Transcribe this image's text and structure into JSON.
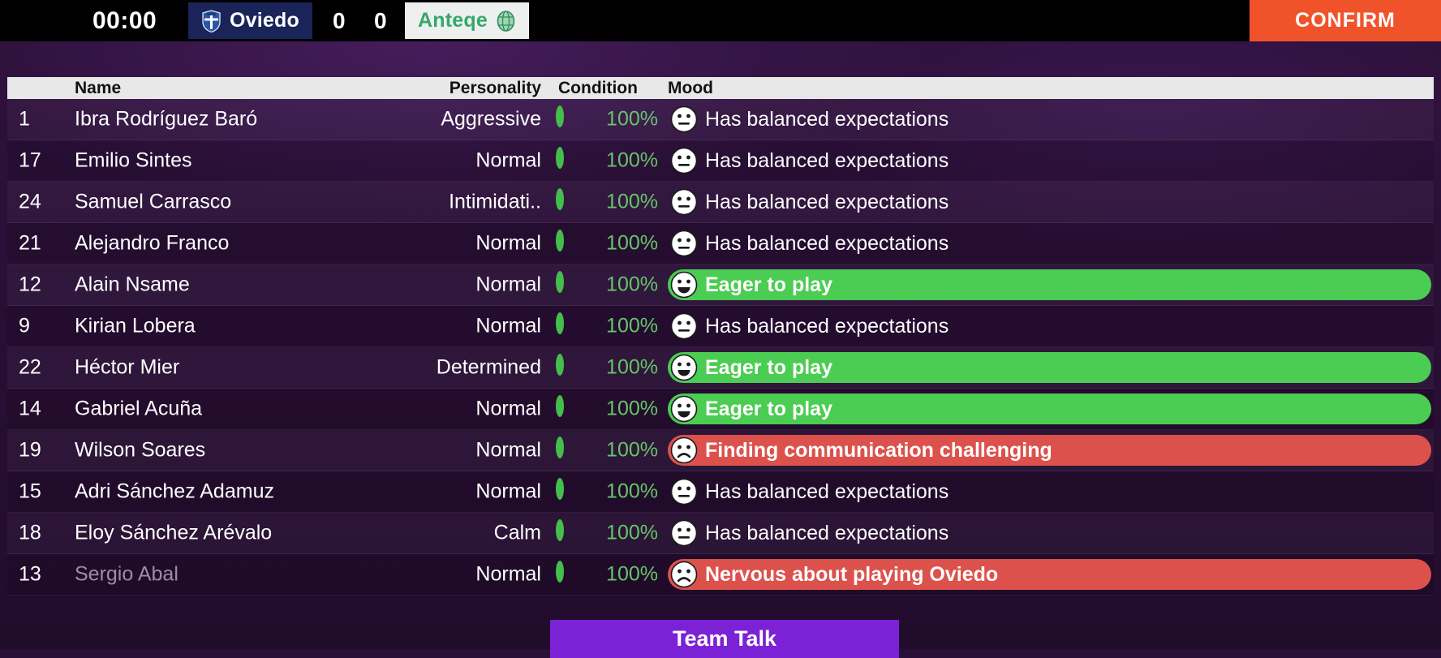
{
  "scoreboard": {
    "clock": "00:00",
    "home_team": "Oviedo",
    "home_score": "0",
    "away_score": "0",
    "away_team": "Anteqe",
    "home_badge_icon": "oviedo-shield-badge-icon",
    "away_badge_icon": "anteqe-circle-badge-icon",
    "confirm_label": "CONFIRM",
    "confirm_color": "#f0532a"
  },
  "table": {
    "columns": [
      "",
      "Name",
      "Personality",
      "Condition",
      "Mood"
    ],
    "rows": [
      {
        "number": "1",
        "name": "Ibra Rodríguez Baró",
        "personality": "Aggressive",
        "condition_icon": "green-ring-icon",
        "condition": "100%",
        "mood": "Has balanced expectations",
        "mood_type": "neutral",
        "mood_face": "neutral-face-icon",
        "dimmed": false
      },
      {
        "number": "17",
        "name": "Emilio Sintes",
        "personality": "Normal",
        "condition_icon": "green-ring-icon",
        "condition": "100%",
        "mood": "Has balanced expectations",
        "mood_type": "neutral",
        "mood_face": "neutral-face-icon",
        "dimmed": false
      },
      {
        "number": "24",
        "name": "Samuel Carrasco",
        "personality": "Intimidati..",
        "condition_icon": "green-ring-icon",
        "condition": "100%",
        "mood": "Has balanced expectations",
        "mood_type": "neutral",
        "mood_face": "neutral-face-icon",
        "dimmed": false
      },
      {
        "number": "21",
        "name": "Alejandro Franco",
        "personality": "Normal",
        "condition_icon": "green-ring-icon",
        "condition": "100%",
        "mood": "Has balanced expectations",
        "mood_type": "neutral",
        "mood_face": "neutral-face-icon",
        "dimmed": false
      },
      {
        "number": "12",
        "name": "Alain Nsame",
        "personality": "Normal",
        "condition_icon": "green-ring-icon",
        "condition": "100%",
        "mood": "Eager to play",
        "mood_type": "positive",
        "mood_face": "happy-face-icon",
        "dimmed": false
      },
      {
        "number": "9",
        "name": "Kirian Lobera",
        "personality": "Normal",
        "condition_icon": "green-ring-icon",
        "condition": "100%",
        "mood": "Has balanced expectations",
        "mood_type": "neutral",
        "mood_face": "neutral-face-icon",
        "dimmed": false
      },
      {
        "number": "22",
        "name": "Héctor Mier",
        "personality": "Determined",
        "condition_icon": "green-ring-icon",
        "condition": "100%",
        "mood": "Eager to play",
        "mood_type": "positive",
        "mood_face": "happy-face-icon",
        "dimmed": false
      },
      {
        "number": "14",
        "name": "Gabriel Acuña",
        "personality": "Normal",
        "condition_icon": "green-ring-icon",
        "condition": "100%",
        "mood": "Eager to play",
        "mood_type": "positive",
        "mood_face": "happy-face-icon",
        "dimmed": false
      },
      {
        "number": "19",
        "name": "Wilson Soares",
        "personality": "Normal",
        "condition_icon": "green-ring-icon",
        "condition": "100%",
        "mood": "Finding communication challenging",
        "mood_type": "negative",
        "mood_face": "sad-face-icon",
        "dimmed": false
      },
      {
        "number": "15",
        "name": "Adri Sánchez Adamuz",
        "personality": "Normal",
        "condition_icon": "green-ring-icon",
        "condition": "100%",
        "mood": "Has balanced expectations",
        "mood_type": "neutral",
        "mood_face": "neutral-face-icon",
        "dimmed": false
      },
      {
        "number": "18",
        "name": "Eloy Sánchez Arévalo",
        "personality": "Calm",
        "condition_icon": "green-ring-icon",
        "condition": "100%",
        "mood": "Has balanced expectations",
        "mood_type": "neutral",
        "mood_face": "neutral-face-icon",
        "dimmed": false
      },
      {
        "number": "13",
        "name": "Sergio Abal",
        "personality": "Normal",
        "condition_icon": "green-ring-icon",
        "condition": "100%",
        "mood": "Nervous about playing Oviedo",
        "mood_type": "negative",
        "mood_face": "sad-face-icon",
        "dimmed": true
      }
    ]
  },
  "footer": {
    "team_talk_label": "Team Talk",
    "team_talk_color": "#7b22d6"
  },
  "colors": {
    "positive_mood": "#4bcc52",
    "negative_mood": "#dd514c",
    "condition_green": "#66c46a",
    "background": "#2a1038"
  }
}
